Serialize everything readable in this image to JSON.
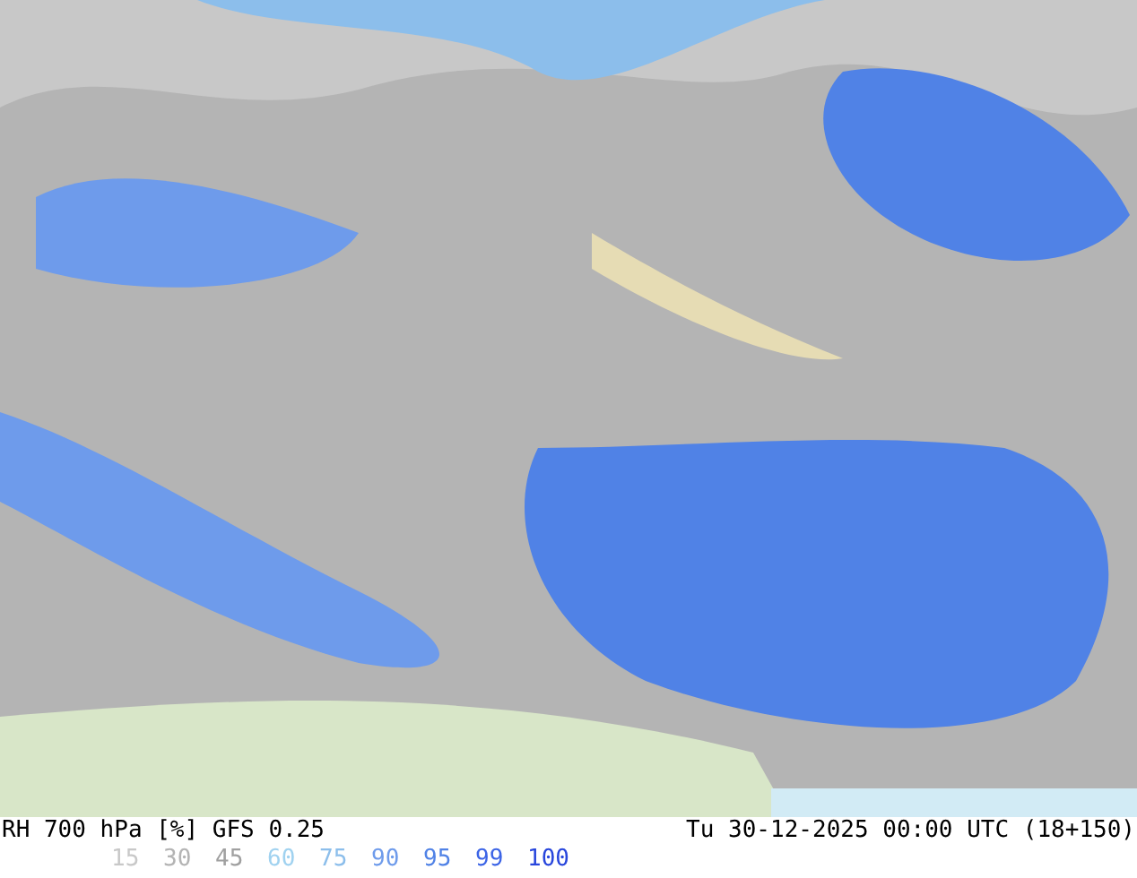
{
  "map": {
    "kind": "humidity-map"
  },
  "footer": {
    "title": "RH 700 hPa [%] GFS 0.25",
    "timestamp": "Tu 30-12-2025 00:00 UTC (18+150)",
    "legend": [
      {
        "label": "15",
        "color": "#c8c8c8"
      },
      {
        "label": "30",
        "color": "#b4b4b4"
      },
      {
        "label": "45",
        "color": "#a0a0a0"
      },
      {
        "label": "60",
        "color": "#a0d2f0"
      },
      {
        "label": "75",
        "color": "#8cbeeb"
      },
      {
        "label": "90",
        "color": "#6e9beb"
      },
      {
        "label": "95",
        "color": "#5082e6"
      },
      {
        "label": "99",
        "color": "#3c64e6"
      },
      {
        "label": "100",
        "color": "#2846dc"
      }
    ]
  }
}
